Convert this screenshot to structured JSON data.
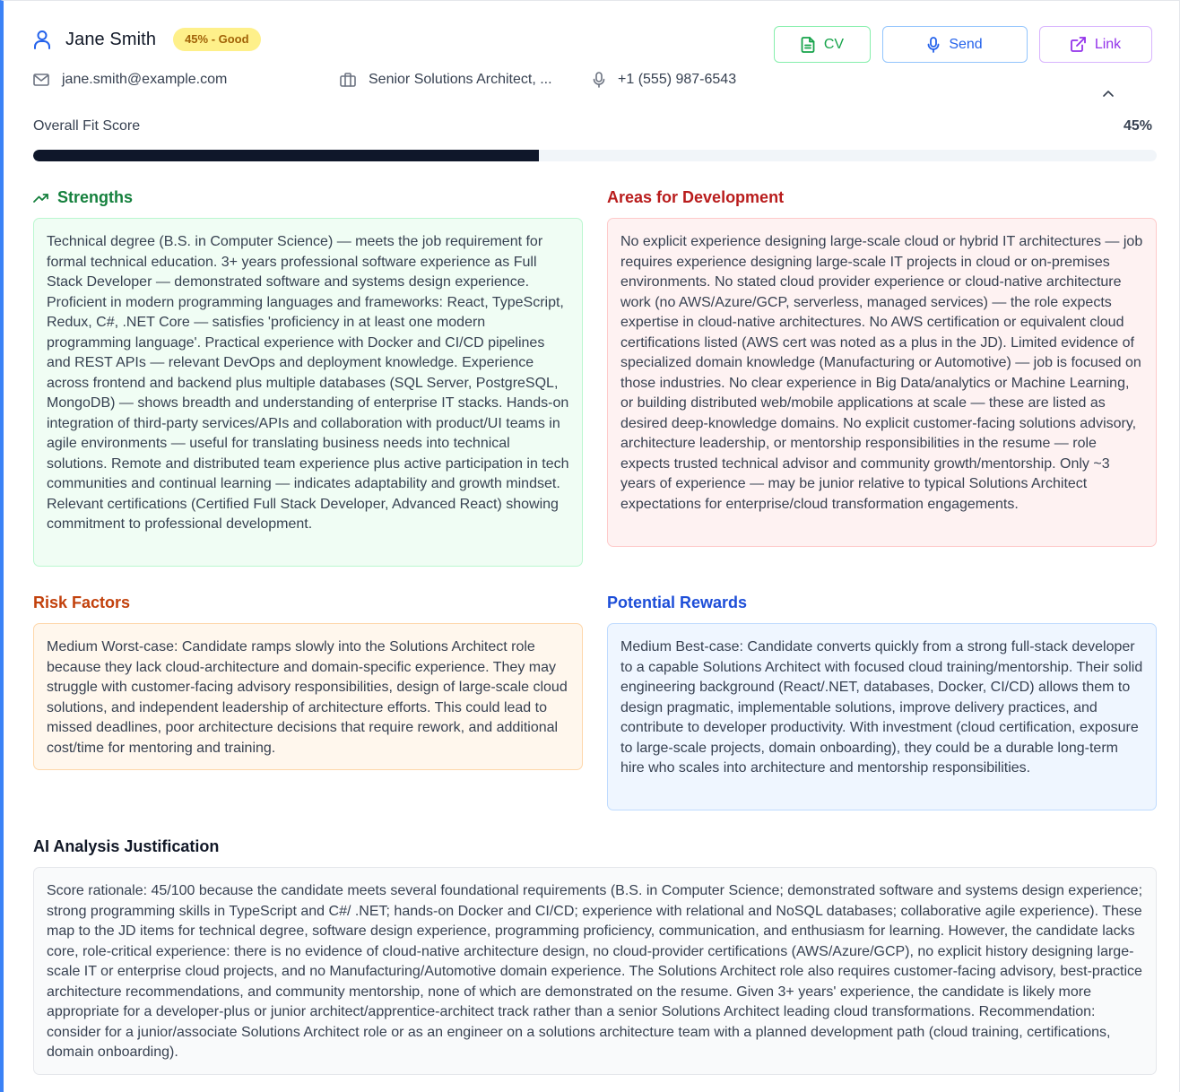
{
  "candidate": {
    "name": "Jane Smith",
    "badge": "45% - Good",
    "email": "jane.smith@example.com",
    "role": "Senior Solutions Architect, ...",
    "phone": "+1 (555) 987-6543"
  },
  "actions": {
    "cv_label": "CV",
    "send_label": "Send",
    "link_label": "Link"
  },
  "fit": {
    "label": "Overall Fit Score",
    "value_text": "45%",
    "value": 45
  },
  "sections": {
    "strengths": {
      "title": "Strengths",
      "text": "Technical degree (B.S. in Computer Science) — meets the job requirement for formal technical education. 3+ years professional software experience as Full Stack Developer — demonstrated software and systems design experience. Proficient in modern programming languages and frameworks: React, TypeScript, Redux, C#, .NET Core — satisfies 'proficiency in at least one modern programming language'. Practical experience with Docker and CI/CD pipelines and REST APIs — relevant DevOps and deployment knowledge. Experience across frontend and backend plus multiple databases (SQL Server, PostgreSQL, MongoDB) — shows breadth and understanding of enterprise IT stacks. Hands-on integration of third-party services/APIs and collaboration with product/UI teams in agile environments — useful for translating business needs into technical solutions. Remote and distributed team experience plus active participation in tech communities and continual learning — indicates adaptability and growth mindset. Relevant certifications (Certified Full Stack Developer, Advanced React) showing commitment to professional development."
    },
    "areas": {
      "title": "Areas for Development",
      "text": "No explicit experience designing large-scale cloud or hybrid IT architectures — job requires experience designing large-scale IT projects in cloud or on-premises environments. No stated cloud provider experience or cloud-native architecture work (no AWS/Azure/GCP, serverless, managed services) — the role expects expertise in cloud-native architectures. No AWS certification or equivalent cloud certifications listed (AWS cert was noted as a plus in the JD). Limited evidence of specialized domain knowledge (Manufacturing or Automotive) — job is focused on those industries. No clear experience in Big Data/analytics or Machine Learning, or building distributed web/mobile applications at scale — these are listed as desired deep-knowledge domains. No explicit customer-facing solutions advisory, architecture leadership, or mentorship responsibilities in the resume — role expects trusted technical advisor and community growth/mentorship. Only ~3 years of experience — may be junior relative to typical Solutions Architect expectations for enterprise/cloud transformation engagements."
    },
    "risk": {
      "title": "Risk Factors",
      "text": "Medium Worst-case: Candidate ramps slowly into the Solutions Architect role because they lack cloud-architecture and domain-specific experience. They may struggle with customer-facing advisory responsibilities, design of large-scale cloud solutions, and independent leadership of architecture efforts. This could lead to missed deadlines, poor architecture decisions that require rework, and additional cost/time for mentoring and training."
    },
    "rewards": {
      "title": "Potential Rewards",
      "text": "Medium Best-case: Candidate converts quickly from a strong full-stack developer to a capable Solutions Architect with focused cloud training/mentorship. Their solid engineering background (React/.NET, databases, Docker, CI/CD) allows them to design pragmatic, implementable solutions, improve delivery practices, and contribute to developer productivity. With investment (cloud certification, exposure to large-scale projects, domain onboarding), they could be a durable long-term hire who scales into architecture and mentorship responsibilities."
    },
    "ai": {
      "title": "AI Analysis Justification",
      "text": "Score rationale: 45/100 because the candidate meets several foundational requirements (B.S. in Computer Science; demonstrated software and systems design experience; strong programming skills in TypeScript and C#/ .NET; hands-on Docker and CI/CD; experience with relational and NoSQL databases; collaborative agile experience). These map to the JD items for technical degree, software design experience, programming proficiency, communication, and enthusiasm for learning. However, the candidate lacks core, role-critical experience: there is no evidence of cloud-native architecture design, no cloud-provider certifications (AWS/Azure/GCP), no explicit history designing large-scale IT or enterprise cloud projects, and no Manufacturing/Automotive domain experience. The Solutions Architect role also requires customer-facing advisory, best-practice architecture recommendations, and community mentorship, none of which are demonstrated on the resume. Given 3+ years' experience, the candidate is likely more appropriate for a developer-plus or junior architect/apprentice-architect track rather than a senior Solutions Architect leading cloud transformations. Recommendation: consider for a junior/associate Solutions Architect role or as an engineer on a solutions architecture team with a planned development path (cloud training, certifications, domain onboarding)."
    }
  },
  "colors": {
    "accent_border": "#3b82f6",
    "progress_fill": "#0f172a",
    "strengths": "#15803d",
    "areas": "#b91c1c",
    "risk": "#c2410c",
    "rewards": "#1d4ed8"
  },
  "icons": {
    "user": "user-icon",
    "email": "mail-icon",
    "role": "briefcase-icon",
    "phone": "microphone-icon",
    "cv": "file-text-icon",
    "send": "microphone-icon",
    "link": "external-link-icon",
    "collapse": "chevron-up-icon",
    "strengths": "trending-up-icon"
  }
}
